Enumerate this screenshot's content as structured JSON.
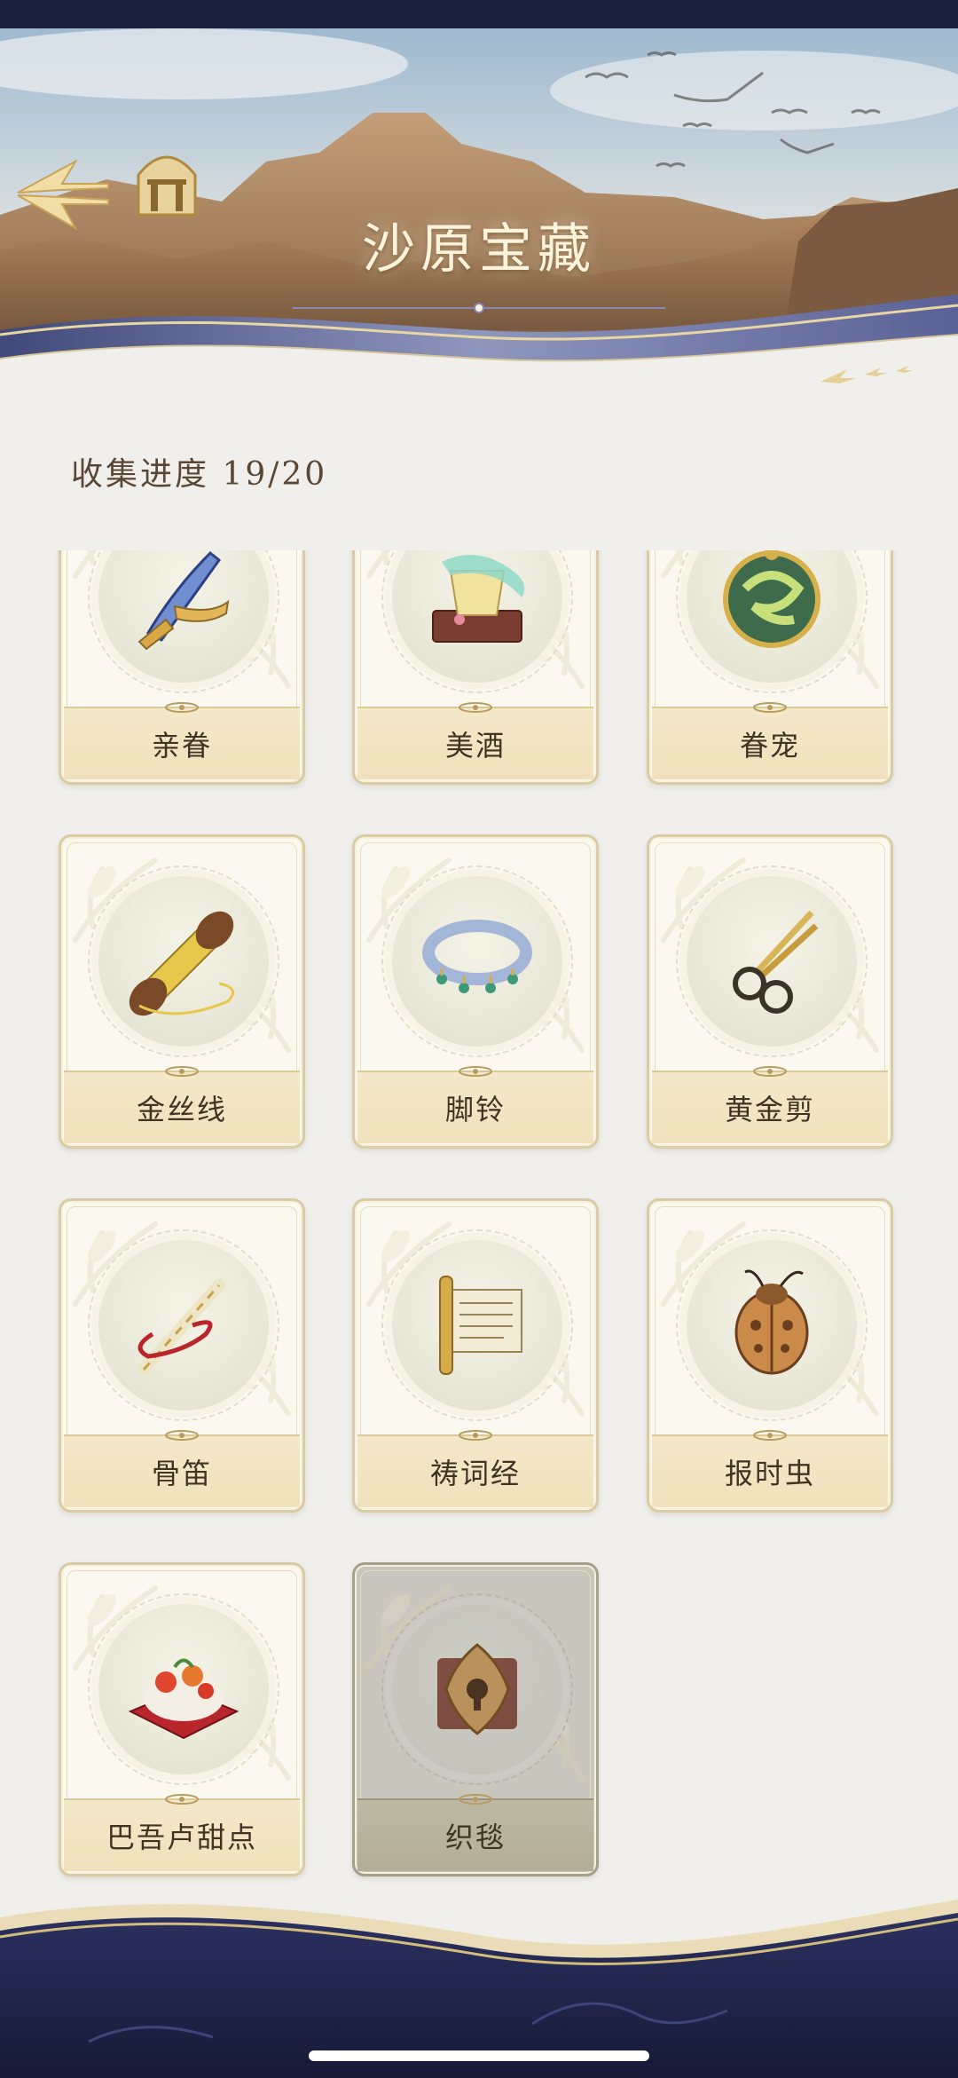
{
  "header": {
    "title": "沙原宝藏",
    "back_icon": "back-arrow-icon",
    "home_icon": "archway-home-icon"
  },
  "progress": {
    "label": "收集进度",
    "value": "19/20",
    "collected": 19,
    "total": 20
  },
  "items": [
    {
      "name": "亲眷",
      "icon": "dagger-icon",
      "locked": false
    },
    {
      "name": "美酒",
      "icon": "wine-cup-icon",
      "locked": false
    },
    {
      "name": "眷宠",
      "icon": "serpent-medallion-icon",
      "locked": false
    },
    {
      "name": "金丝线",
      "icon": "golden-thread-spool-icon",
      "locked": false
    },
    {
      "name": "脚铃",
      "icon": "anklet-icon",
      "locked": false
    },
    {
      "name": "黄金剪",
      "icon": "golden-scissors-icon",
      "locked": false
    },
    {
      "name": "骨笛",
      "icon": "bone-flute-icon",
      "locked": false
    },
    {
      "name": "祷词经",
      "icon": "prayer-scroll-icon",
      "locked": false
    },
    {
      "name": "报时虫",
      "icon": "beetle-icon",
      "locked": false
    },
    {
      "name": "巴吾卢甜点",
      "icon": "dessert-icon",
      "locked": false
    },
    {
      "name": "织毯",
      "icon": "carpet-emblem-icon",
      "locked": true
    }
  ],
  "colors": {
    "background": "#f0efec",
    "card_bg": "#fbf9ef",
    "card_border": "#dacba4",
    "label_bar": "#f3e8c8",
    "text": "#3f3324",
    "locked_card": "#c9c7bd",
    "footer_navy": "#1d2140"
  }
}
